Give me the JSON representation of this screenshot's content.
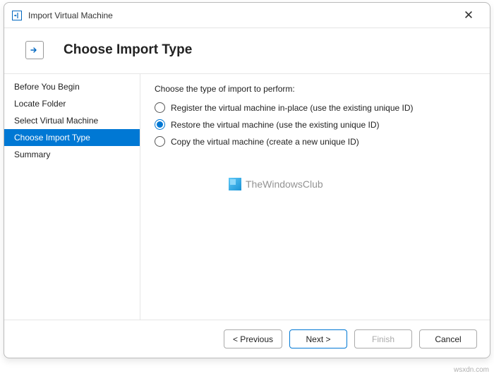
{
  "window": {
    "title": "Import Virtual Machine"
  },
  "header": {
    "title": "Choose Import Type"
  },
  "sidebar": {
    "items": [
      {
        "label": "Before You Begin",
        "active": false
      },
      {
        "label": "Locate Folder",
        "active": false
      },
      {
        "label": "Select Virtual Machine",
        "active": false
      },
      {
        "label": "Choose Import Type",
        "active": true
      },
      {
        "label": "Summary",
        "active": false
      }
    ]
  },
  "content": {
    "prompt": "Choose the type of import to perform:",
    "options": [
      {
        "label": "Register the virtual machine in-place (use the existing unique ID)",
        "selected": false
      },
      {
        "label": "Restore the virtual machine (use the existing unique ID)",
        "selected": true
      },
      {
        "label": "Copy the virtual machine (create a new unique ID)",
        "selected": false
      }
    ]
  },
  "watermark": {
    "text": "TheWindowsClub"
  },
  "footer": {
    "previous": "< Previous",
    "next": "Next >",
    "finish": "Finish",
    "cancel": "Cancel"
  },
  "corner": {
    "text": "wsxdn.com"
  }
}
